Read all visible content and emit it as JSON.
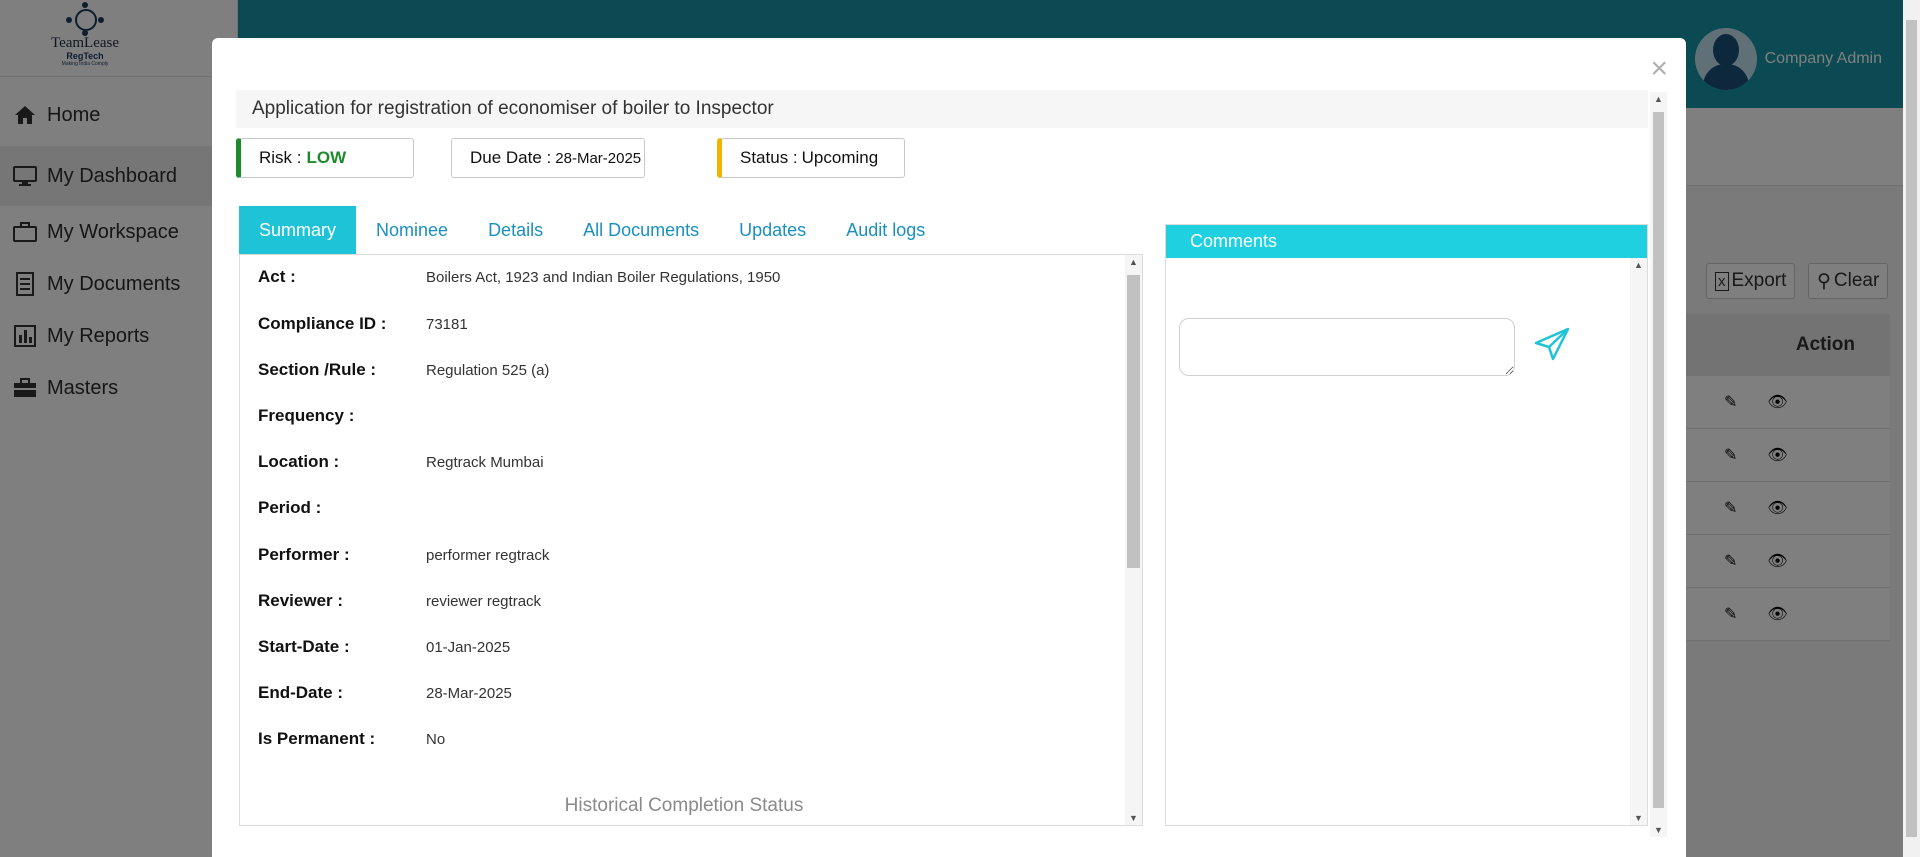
{
  "sidebar": {
    "logo": {
      "name": "TeamLease",
      "sub": "RegTech",
      "tag": "Making India Comply"
    },
    "items": [
      {
        "label": "Home",
        "icon": "home-icon"
      },
      {
        "label": "My Dashboard",
        "icon": "monitor-icon"
      },
      {
        "label": "My Workspace",
        "icon": "briefcase-icon"
      },
      {
        "label": "My Documents",
        "icon": "document-icon"
      },
      {
        "label": "My Reports",
        "icon": "bar-chart-icon"
      },
      {
        "label": "Masters",
        "icon": "toolbox-icon"
      }
    ]
  },
  "header": {
    "user_name": "Company Admin"
  },
  "toolbar": {
    "export_label": "Export",
    "clear_label": "Clear"
  },
  "table": {
    "action_header": "Action"
  },
  "modal": {
    "title": "Application for registration of economiser of boiler to Inspector",
    "risk_label": "Risk : ",
    "risk_value": "LOW",
    "due_label": "Due Date : ",
    "due_value": "28-Mar-2025",
    "status_label": "Status : ",
    "status_value": "Upcoming",
    "tabs": [
      "Summary",
      "Nominee",
      "Details",
      "All Documents",
      "Updates",
      "Audit logs"
    ],
    "summary": [
      {
        "label": "Act :",
        "value": "Boilers Act, 1923 and Indian Boiler Regulations, 1950"
      },
      {
        "label": "Compliance ID :",
        "value": "73181"
      },
      {
        "label": "Section /Rule :",
        "value": "Regulation 525 (a)"
      },
      {
        "label": "Frequency :",
        "value": ""
      },
      {
        "label": "Location :",
        "value": "Regtrack Mumbai"
      },
      {
        "label": "Period :",
        "value": ""
      },
      {
        "label": "Performer :",
        "value": "performer regtrack"
      },
      {
        "label": "Reviewer :",
        "value": "reviewer regtrack"
      },
      {
        "label": "Start-Date :",
        "value": "01-Jan-2025"
      },
      {
        "label": "End-Date :",
        "value": "28-Mar-2025"
      },
      {
        "label": "Is Permanent :",
        "value": "No"
      }
    ],
    "historical_title": "Historical Completion Status",
    "comments_title": "Comments",
    "comment_value": ""
  },
  "colors": {
    "accent": "#1fc3d8",
    "risk_low": "#1e8a2e",
    "status_upcoming": "#f0b400",
    "topbar": "#1694a6"
  }
}
